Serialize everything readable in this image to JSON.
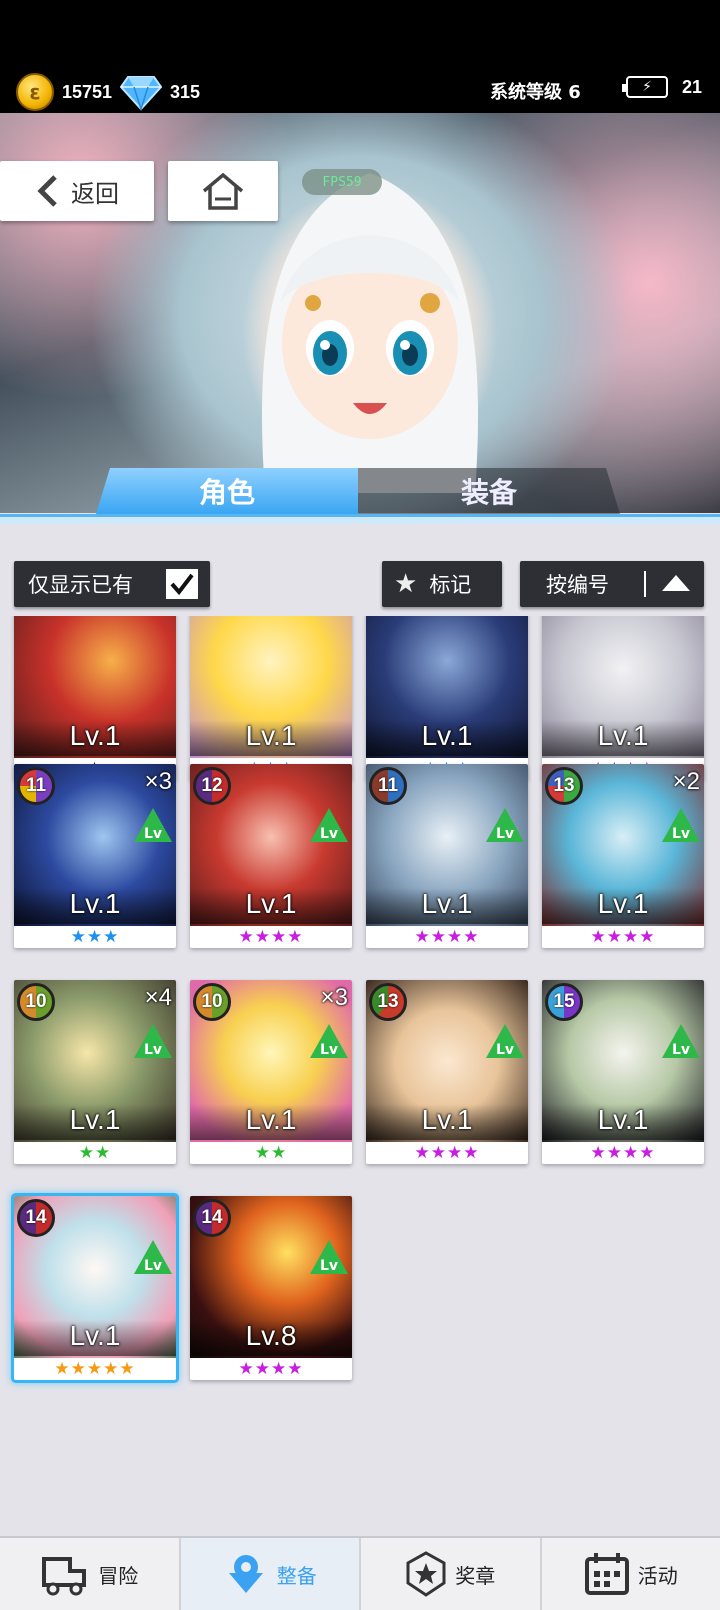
{
  "top_bar": {
    "gold": "15751",
    "gems": "315",
    "system_level": "系统等级 6",
    "energy": "21",
    "coin_icon": "gold-coin-icon",
    "gem_icon": "diamond-gem-icon",
    "energy_icon": "battery-lightning-icon"
  },
  "hero": {
    "back_label": "返回",
    "home_icon": "home-icon",
    "fps": "FPS59"
  },
  "tabs": [
    {
      "label": "角色",
      "active": true
    },
    {
      "label": "装备",
      "active": false
    }
  ],
  "filters": {
    "owned_only_label": "仅显示已有",
    "owned_only_checked": true,
    "mark_label": "标记",
    "sort_label": "按编号"
  },
  "cards": [
    {
      "level": "Lv.1",
      "stars": "★",
      "star_color": "s-black",
      "badge": "",
      "multiplier": ""
    },
    {
      "level": "Lv.1",
      "stars": "★★★",
      "star_color": "s-blue",
      "badge": "",
      "multiplier": ""
    },
    {
      "level": "Lv.1",
      "stars": "★★★",
      "star_color": "s-blue",
      "badge": "",
      "multiplier": ""
    },
    {
      "level": "Lv.1",
      "stars": "★★★★",
      "star_color": "s-purple",
      "badge": "",
      "multiplier": ""
    },
    {
      "level": "Lv.1",
      "stars": "★★★",
      "star_color": "s-blue",
      "badge": "11",
      "multiplier": "×3"
    },
    {
      "level": "Lv.1",
      "stars": "★★★★",
      "star_color": "s-purple",
      "badge": "12",
      "multiplier": ""
    },
    {
      "level": "Lv.1",
      "stars": "★★★★",
      "star_color": "s-purple",
      "badge": "11",
      "multiplier": ""
    },
    {
      "level": "Lv.1",
      "stars": "★★★★",
      "star_color": "s-purple",
      "badge": "13",
      "multiplier": "×2"
    },
    {
      "level": "Lv.1",
      "stars": "★★",
      "star_color": "s-green",
      "badge": "10",
      "multiplier": "×4"
    },
    {
      "level": "Lv.1",
      "stars": "★★",
      "star_color": "s-green",
      "badge": "10",
      "multiplier": "×3"
    },
    {
      "level": "Lv.1",
      "stars": "★★★★",
      "star_color": "s-purple",
      "badge": "13",
      "multiplier": ""
    },
    {
      "level": "Lv.1",
      "stars": "★★★★",
      "star_color": "s-purple",
      "badge": "15",
      "multiplier": ""
    },
    {
      "level": "Lv.1",
      "stars": "★★★★★",
      "star_color": "s-orange",
      "badge": "14",
      "multiplier": ""
    },
    {
      "level": "Lv.8",
      "stars": "★★★★",
      "star_color": "s-purple",
      "badge": "14",
      "multiplier": ""
    }
  ],
  "lv_up_label": "Lv",
  "bottom_nav": [
    {
      "label": "冒险",
      "icon": "truck-icon",
      "active": false
    },
    {
      "label": "整备",
      "icon": "gear-heart-icon",
      "active": true
    },
    {
      "label": "奖章",
      "icon": "star-medal-icon",
      "active": false
    },
    {
      "label": "活动",
      "icon": "calendar-icon",
      "active": false
    }
  ]
}
